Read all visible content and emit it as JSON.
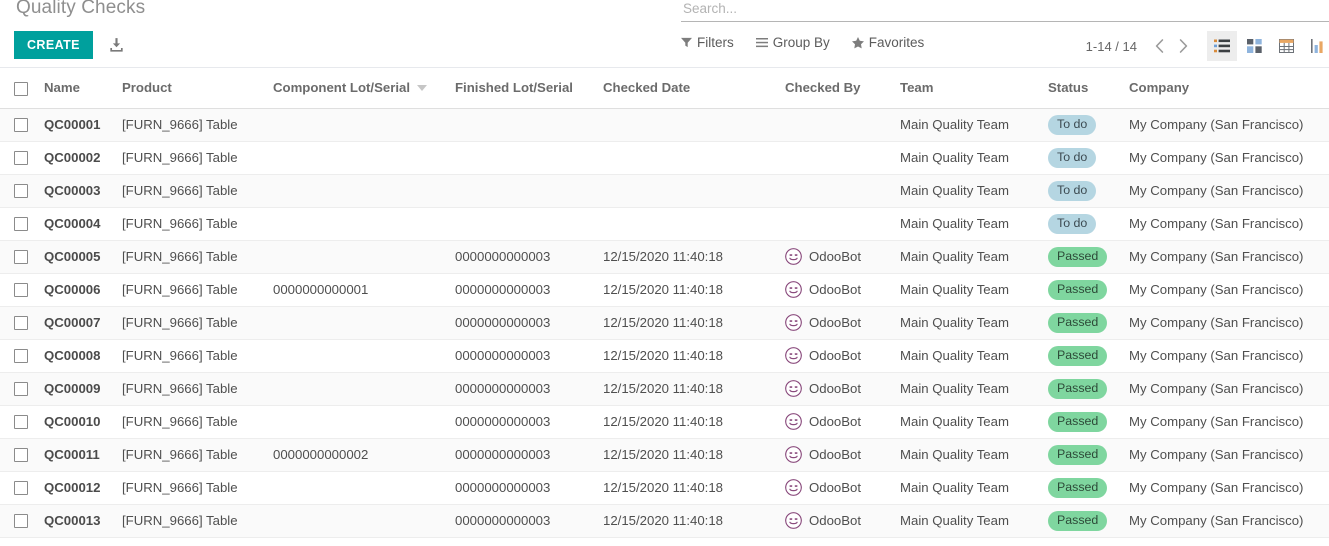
{
  "breadcrumb": "Quality Checks",
  "buttons": {
    "create": "CREATE",
    "import_icon": "import-icon"
  },
  "search": {
    "placeholder": "Search...",
    "value": ""
  },
  "menus": [
    {
      "label": "Filters",
      "icon": "filter-icon"
    },
    {
      "label": "Group By",
      "icon": "list-lines-icon"
    },
    {
      "label": "Favorites",
      "icon": "star-icon"
    }
  ],
  "pager": {
    "value": "1-14 / 14",
    "prev": "chevron-left-icon",
    "next": "chevron-right-icon"
  },
  "views": [
    {
      "name": "list",
      "active": true
    },
    {
      "name": "kanban",
      "active": false
    },
    {
      "name": "pivot",
      "active": false
    },
    {
      "name": "graph",
      "active": false
    }
  ],
  "table": {
    "columns": [
      {
        "key": "select",
        "label": ""
      },
      {
        "key": "name",
        "label": "Name"
      },
      {
        "key": "product",
        "label": "Product"
      },
      {
        "key": "component_lot",
        "label": "Component Lot/Serial",
        "sorted": true
      },
      {
        "key": "finished_lot",
        "label": "Finished Lot/Serial"
      },
      {
        "key": "checked_date",
        "label": "Checked Date"
      },
      {
        "key": "checked_by",
        "label": "Checked By"
      },
      {
        "key": "team",
        "label": "Team"
      },
      {
        "key": "status",
        "label": "Status"
      },
      {
        "key": "company",
        "label": "Company"
      }
    ],
    "rows": [
      {
        "name": "QC00001",
        "product": "[FURN_9666] Table",
        "component_lot": "",
        "finished_lot": "",
        "checked_date": "",
        "checked_by": "",
        "team": "Main Quality Team",
        "status": "To do",
        "status_kind": "todo",
        "company": "My Company (San Francisco)"
      },
      {
        "name": "QC00002",
        "product": "[FURN_9666] Table",
        "component_lot": "",
        "finished_lot": "",
        "checked_date": "",
        "checked_by": "",
        "team": "Main Quality Team",
        "status": "To do",
        "status_kind": "todo",
        "company": "My Company (San Francisco)"
      },
      {
        "name": "QC00003",
        "product": "[FURN_9666] Table",
        "component_lot": "",
        "finished_lot": "",
        "checked_date": "",
        "checked_by": "",
        "team": "Main Quality Team",
        "status": "To do",
        "status_kind": "todo",
        "company": "My Company (San Francisco)"
      },
      {
        "name": "QC00004",
        "product": "[FURN_9666] Table",
        "component_lot": "",
        "finished_lot": "",
        "checked_date": "",
        "checked_by": "",
        "team": "Main Quality Team",
        "status": "To do",
        "status_kind": "todo",
        "company": "My Company (San Francisco)"
      },
      {
        "name": "QC00005",
        "product": "[FURN_9666] Table",
        "component_lot": "",
        "finished_lot": "0000000000003",
        "checked_date": "12/15/2020 11:40:18",
        "checked_by": "OdooBot",
        "team": "Main Quality Team",
        "status": "Passed",
        "status_kind": "passed",
        "company": "My Company (San Francisco)"
      },
      {
        "name": "QC00006",
        "product": "[FURN_9666] Table",
        "component_lot": "0000000000001",
        "finished_lot": "0000000000003",
        "checked_date": "12/15/2020 11:40:18",
        "checked_by": "OdooBot",
        "team": "Main Quality Team",
        "status": "Passed",
        "status_kind": "passed",
        "company": "My Company (San Francisco)"
      },
      {
        "name": "QC00007",
        "product": "[FURN_9666] Table",
        "component_lot": "",
        "finished_lot": "0000000000003",
        "checked_date": "12/15/2020 11:40:18",
        "checked_by": "OdooBot",
        "team": "Main Quality Team",
        "status": "Passed",
        "status_kind": "passed",
        "company": "My Company (San Francisco)"
      },
      {
        "name": "QC00008",
        "product": "[FURN_9666] Table",
        "component_lot": "",
        "finished_lot": "0000000000003",
        "checked_date": "12/15/2020 11:40:18",
        "checked_by": "OdooBot",
        "team": "Main Quality Team",
        "status": "Passed",
        "status_kind": "passed",
        "company": "My Company (San Francisco)"
      },
      {
        "name": "QC00009",
        "product": "[FURN_9666] Table",
        "component_lot": "",
        "finished_lot": "0000000000003",
        "checked_date": "12/15/2020 11:40:18",
        "checked_by": "OdooBot",
        "team": "Main Quality Team",
        "status": "Passed",
        "status_kind": "passed",
        "company": "My Company (San Francisco)"
      },
      {
        "name": "QC00010",
        "product": "[FURN_9666] Table",
        "component_lot": "",
        "finished_lot": "0000000000003",
        "checked_date": "12/15/2020 11:40:18",
        "checked_by": "OdooBot",
        "team": "Main Quality Team",
        "status": "Passed",
        "status_kind": "passed",
        "company": "My Company (San Francisco)"
      },
      {
        "name": "QC00011",
        "product": "[FURN_9666] Table",
        "component_lot": "0000000000002",
        "finished_lot": "0000000000003",
        "checked_date": "12/15/2020 11:40:18",
        "checked_by": "OdooBot",
        "team": "Main Quality Team",
        "status": "Passed",
        "status_kind": "passed",
        "company": "My Company (San Francisco)"
      },
      {
        "name": "QC00012",
        "product": "[FURN_9666] Table",
        "component_lot": "",
        "finished_lot": "0000000000003",
        "checked_date": "12/15/2020 11:40:18",
        "checked_by": "OdooBot",
        "team": "Main Quality Team",
        "status": "Passed",
        "status_kind": "passed",
        "company": "My Company (San Francisco)"
      },
      {
        "name": "QC00013",
        "product": "[FURN_9666] Table",
        "component_lot": "",
        "finished_lot": "0000000000003",
        "checked_date": "12/15/2020 11:40:18",
        "checked_by": "OdooBot",
        "team": "Main Quality Team",
        "status": "Passed",
        "status_kind": "passed",
        "company": "My Company (San Francisco)"
      }
    ]
  },
  "colors": {
    "accent": "#00a09d",
    "badge_todo_bg": "#b5d6e2",
    "badge_passed_bg": "#7fd69f",
    "avatar": "#8a4b7d"
  }
}
